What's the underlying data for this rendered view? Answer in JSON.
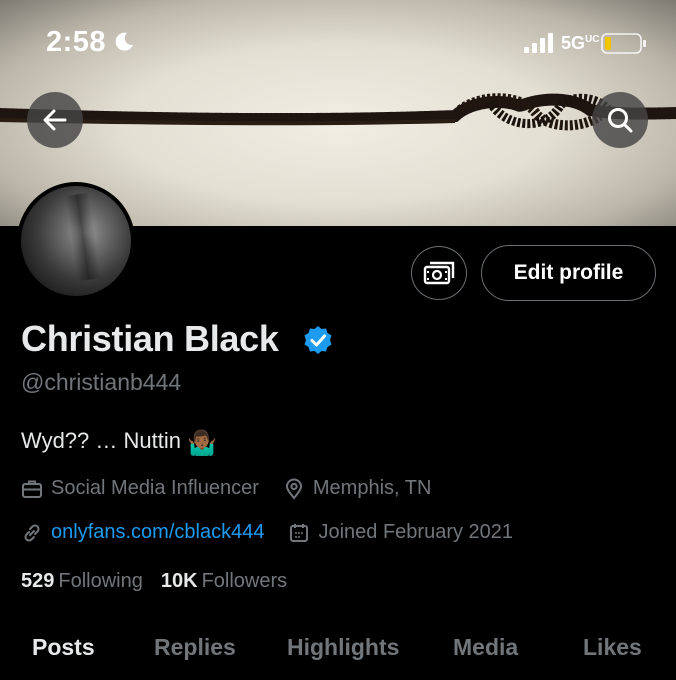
{
  "status_bar": {
    "time": "2:58",
    "network": "5G",
    "network_sup": "UC"
  },
  "profile": {
    "display_name": "Christian Black",
    "handle": "@christianb444",
    "bio": "Wyd?? … Nuttin",
    "bio_emoji": "🤷🏾‍♂️",
    "category": "Social Media Influencer",
    "location": "Memphis, TN",
    "website": "onlyfans.com/cblack444",
    "joined": "Joined February 2021",
    "following_count": "529",
    "following_label": "Following",
    "followers_count": "10K",
    "followers_label": "Followers"
  },
  "actions": {
    "edit_profile": "Edit profile"
  },
  "tabs": [
    {
      "label": "Posts",
      "active": true
    },
    {
      "label": "Replies",
      "active": false
    },
    {
      "label": "Highlights",
      "active": false
    },
    {
      "label": "Media",
      "active": false
    },
    {
      "label": "Likes",
      "active": false
    }
  ],
  "colors": {
    "background": "#000000",
    "text_primary": "#e7e9ea",
    "text_secondary": "#71767b",
    "link": "#1d9bf0",
    "verified": "#1d9bf0"
  },
  "icons": {
    "back": "arrow-left-icon",
    "search": "search-icon",
    "subscribe": "money-icon",
    "verified": "verified-badge-icon",
    "category": "briefcase-icon",
    "location": "location-pin-icon",
    "website": "link-icon",
    "joined": "calendar-icon"
  }
}
